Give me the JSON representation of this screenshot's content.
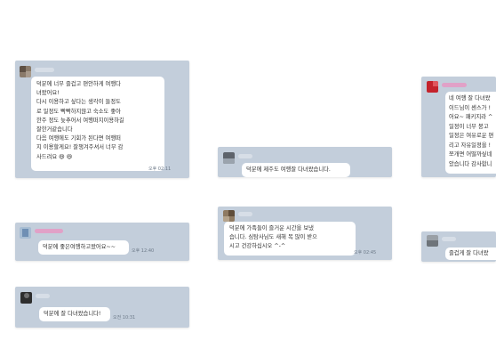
{
  "reviews": [
    {
      "lines": [
        "덕분에 너무 즐겁고 편안하게 여행다",
        "녀왔어요!",
        "다시 이용하고 싶다는 생각이 들정도",
        "로 일정도 빡빡하지않고 숙소도 좋아",
        "한주 정도 늦추어서 여행떠지이용하길",
        "잘한거같습니다",
        "다음 여행에도 기회가 된다면 여행떠",
        "지 이용할게요! 잘챙겨주셔서 너무 감",
        "사드려요 😆 😆"
      ],
      "time": "오후 02:11"
    },
    {
      "lines": [
        "덕분에 좋은여행하고왔어요~~"
      ],
      "time": "오후 12:40"
    },
    {
      "lines": [
        "덕분에 잘 다녀왔습니다!"
      ],
      "time": "오전 10:31"
    },
    {
      "lines": [
        "덕분에 제주도 여행잘 다녀왔습니다."
      ],
      "time": ""
    },
    {
      "lines": [
        "덕분에 가족들이 즐거운 시간을 보냈",
        "습니다. 심탐사님도 새해 복 많이 받으",
        "시고 건강하십시오 ^-^"
      ],
      "time": "오후 02:45"
    },
    {
      "lines": [
        "네 여행 잘 다녀왔",
        "이드님이 센스가 !",
        "어요~ 패키지라 ^",
        "일정이 너무 붕고",
        "일정은 여유로운 편",
        "리고 자유일정을 !",
        "쪼개면 어떨까싶네",
        "았습니다 감사합니"
      ],
      "time": ""
    },
    {
      "lines": [
        "즐겁게 잘 다녀왔"
      ],
      "time": ""
    }
  ]
}
